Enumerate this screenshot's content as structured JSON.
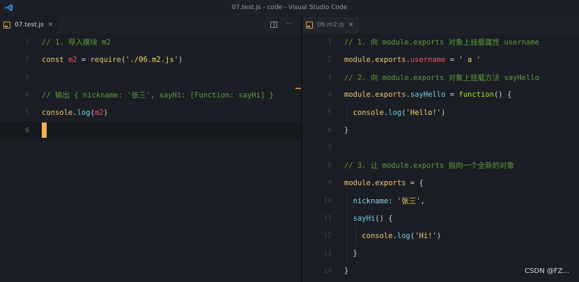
{
  "window": {
    "title": "07.test.js - code - Visual Studio Code"
  },
  "left": {
    "tab": {
      "label": "07.test.js"
    },
    "lines": [
      {
        "n": "1",
        "segs": [
          {
            "c": "cm",
            "t": "// 1. 导入模块 m2"
          }
        ]
      },
      {
        "n": "2",
        "segs": [
          {
            "c": "kw",
            "t": "const "
          },
          {
            "c": "var",
            "t": "m2"
          },
          {
            "c": "pl",
            "t": " = "
          },
          {
            "c": "fn",
            "t": "require"
          },
          {
            "c": "pl",
            "t": "("
          },
          {
            "c": "st",
            "t": "'./06.m2.js'"
          },
          {
            "c": "pl",
            "t": ")"
          }
        ]
      },
      {
        "n": "3",
        "segs": []
      },
      {
        "n": "4",
        "segs": [
          {
            "c": "cm",
            "t": "// 输出 { nickname: '张三', sayHi: [Function: sayHi] }"
          }
        ]
      },
      {
        "n": "5",
        "segs": [
          {
            "c": "kw",
            "t": "console"
          },
          {
            "c": "pl",
            "t": "."
          },
          {
            "c": "method",
            "t": "log"
          },
          {
            "c": "pl",
            "t": "("
          },
          {
            "c": "var",
            "t": "m2"
          },
          {
            "c": "pl",
            "t": ")"
          }
        ]
      },
      {
        "n": "6",
        "segs": []
      }
    ]
  },
  "right": {
    "tab": {
      "label": "06.m2.js"
    },
    "lines": [
      {
        "n": "1",
        "segs": [
          {
            "c": "cm",
            "t": "// 1. 向 module.exports 对象上挂载属性 username"
          }
        ]
      },
      {
        "n": "2",
        "segs": [
          {
            "c": "kw",
            "t": "module"
          },
          {
            "c": "pl",
            "t": "."
          },
          {
            "c": "kw",
            "t": "exports"
          },
          {
            "c": "pl",
            "t": "."
          },
          {
            "c": "var",
            "t": "username"
          },
          {
            "c": "pl",
            "t": " = "
          },
          {
            "c": "st",
            "t": "' a '"
          }
        ]
      },
      {
        "n": "3",
        "segs": [
          {
            "c": "cm",
            "t": "// 2. 向 module.exports 对象上挂载方法 sayHello"
          }
        ]
      },
      {
        "n": "4",
        "segs": [
          {
            "c": "kw",
            "t": "module"
          },
          {
            "c": "pl",
            "t": "."
          },
          {
            "c": "kw",
            "t": "exports"
          },
          {
            "c": "pl",
            "t": "."
          },
          {
            "c": "method",
            "t": "sayHello"
          },
          {
            "c": "pl",
            "t": " = "
          },
          {
            "c": "fnkw",
            "t": "function"
          },
          {
            "c": "pl",
            "t": "() {"
          }
        ]
      },
      {
        "n": "5",
        "segs": [
          {
            "c": "pl",
            "t": "  "
          },
          {
            "c": "kw",
            "t": "console"
          },
          {
            "c": "pl",
            "t": "."
          },
          {
            "c": "method",
            "t": "log"
          },
          {
            "c": "pl",
            "t": "("
          },
          {
            "c": "st",
            "t": "'Hello!'"
          },
          {
            "c": "pl",
            "t": ")"
          }
        ]
      },
      {
        "n": "6",
        "segs": [
          {
            "c": "pl",
            "t": "}"
          }
        ]
      },
      {
        "n": "7",
        "segs": []
      },
      {
        "n": "8",
        "segs": [
          {
            "c": "cm",
            "t": "// 3. 让 module.exports 指向一个全新的对象"
          }
        ]
      },
      {
        "n": "9",
        "segs": [
          {
            "c": "kw",
            "t": "module"
          },
          {
            "c": "pl",
            "t": "."
          },
          {
            "c": "kw",
            "t": "exports"
          },
          {
            "c": "pl",
            "t": " = {"
          }
        ]
      },
      {
        "n": "10",
        "segs": [
          {
            "c": "pl",
            "t": "  "
          },
          {
            "c": "id",
            "t": "nickname"
          },
          {
            "c": "pl",
            "t": ": "
          },
          {
            "c": "st",
            "t": "'张三'"
          },
          {
            "c": "pl",
            "t": ","
          }
        ]
      },
      {
        "n": "11",
        "segs": [
          {
            "c": "pl",
            "t": "  "
          },
          {
            "c": "method",
            "t": "sayHi"
          },
          {
            "c": "pl",
            "t": "() {"
          }
        ]
      },
      {
        "n": "12",
        "segs": [
          {
            "c": "pl",
            "t": "    "
          },
          {
            "c": "kw",
            "t": "console"
          },
          {
            "c": "pl",
            "t": "."
          },
          {
            "c": "method",
            "t": "log"
          },
          {
            "c": "pl",
            "t": "("
          },
          {
            "c": "st",
            "t": "'Hi!'"
          },
          {
            "c": "pl",
            "t": ")"
          }
        ]
      },
      {
        "n": "13",
        "segs": [
          {
            "c": "pl",
            "t": "  }"
          }
        ]
      },
      {
        "n": "14",
        "segs": [
          {
            "c": "pl",
            "t": "}"
          }
        ]
      }
    ]
  },
  "watermark": "CSDN @FZ...",
  "colors": {
    "accent": "#efb44d",
    "comment": "#5e9e3a"
  },
  "icons": {
    "app": "vscode-icon",
    "file": "js-file-icon",
    "close": "close-icon",
    "split": "split-editor-icon",
    "more": "more-actions-icon"
  }
}
